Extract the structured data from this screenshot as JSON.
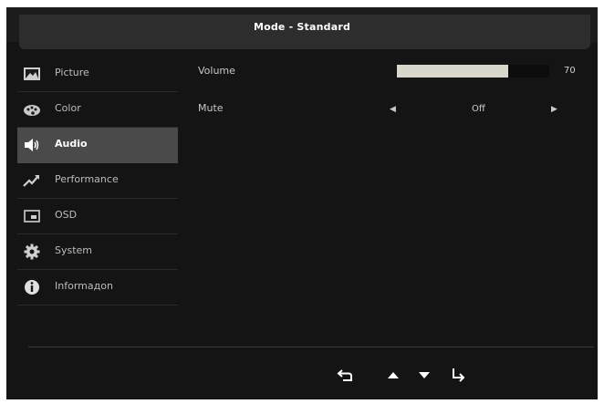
{
  "header": {
    "title": "Mode - Standard"
  },
  "sidebar": {
    "items": [
      {
        "label": "Picture",
        "icon": "picture-icon"
      },
      {
        "label": "Color",
        "icon": "color-palette-icon"
      },
      {
        "label": "Audio",
        "icon": "speaker-icon",
        "selected": true
      },
      {
        "label": "Performance",
        "icon": "performance-graph-icon"
      },
      {
        "label": "OSD",
        "icon": "osd-icon"
      },
      {
        "label": "System",
        "icon": "gear-icon"
      },
      {
        "label": "Informaдon",
        "icon": "info-icon"
      }
    ]
  },
  "settings": {
    "volume": {
      "label": "Volume",
      "value": "70",
      "level": 0.73
    },
    "mute": {
      "label": "Mute",
      "value": "Off"
    }
  },
  "nav": {
    "buttons": [
      "back-icon",
      "up-arrow-icon",
      "down-arrow-icon",
      "enter-icon"
    ]
  },
  "colors": {
    "background": "#141414",
    "selected_item": "#4a4a4a",
    "bar_fill": "#d9d6cc",
    "text": "#c8c8c8"
  }
}
